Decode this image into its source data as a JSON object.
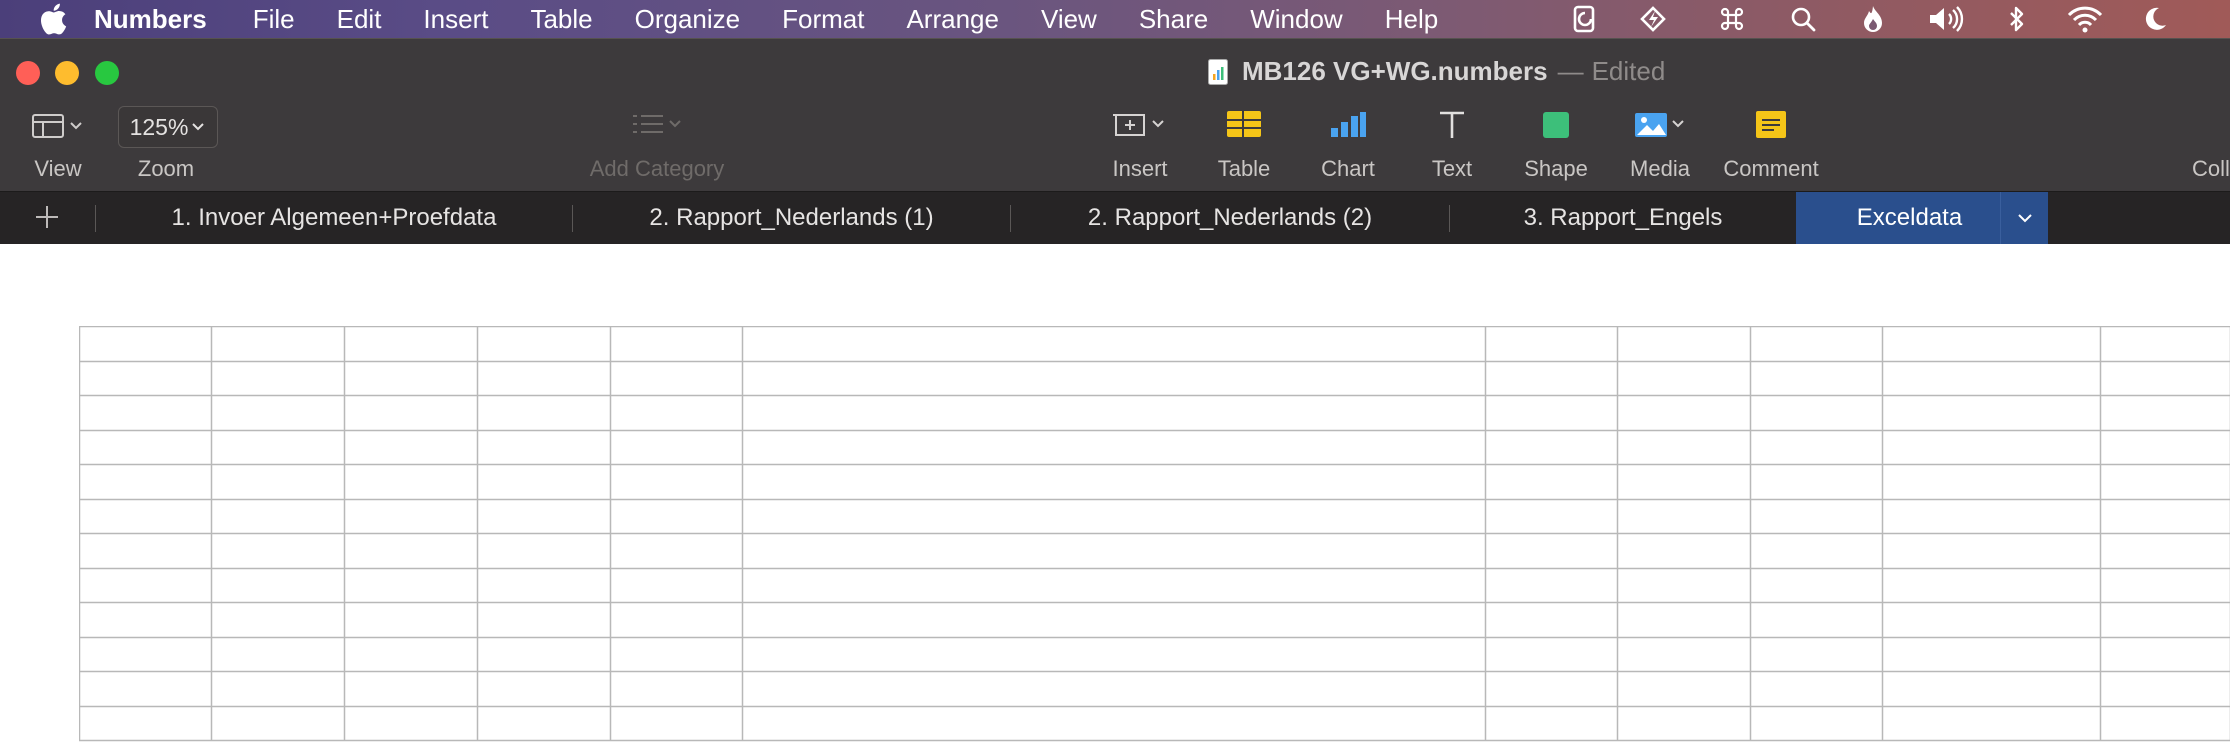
{
  "menubar": {
    "app_name": "Numbers",
    "items": [
      "File",
      "Edit",
      "Insert",
      "Table",
      "Organize",
      "Format",
      "Arrange",
      "View",
      "Share",
      "Window",
      "Help"
    ],
    "status_icons": [
      "clipboard-icon",
      "bolt-app-icon",
      "command-icon",
      "search-icon",
      "flame-icon",
      "volume-icon",
      "bluetooth-icon",
      "wifi-icon",
      "moon-icon"
    ]
  },
  "window": {
    "title": "MB126 VG+WG.numbers",
    "title_separator": "—",
    "status": "Edited"
  },
  "toolbar": {
    "view_label": "View",
    "zoom_value": "125%",
    "zoom_label": "Zoom",
    "add_category_label": "Add Category",
    "insert_label": "Insert",
    "table_label": "Table",
    "chart_label": "Chart",
    "text_label": "Text",
    "shape_label": "Shape",
    "media_label": "Media",
    "comment_label": "Comment",
    "collaborate_label": "Coll"
  },
  "sheets": {
    "tabs": [
      {
        "label": "1. Invoer Algemeen+Proefdata",
        "active": false
      },
      {
        "label": "2. Rapport_Nederlands (1)",
        "active": false
      },
      {
        "label": "2. Rapport_Nederlands (2)",
        "active": false
      },
      {
        "label": "3. Rapport_Engels",
        "active": false
      },
      {
        "label": "Exceldata",
        "active": true
      }
    ]
  },
  "table": {
    "visible_rows": 12,
    "visible_columns": 11
  },
  "colors": {
    "toolbar_bg": "#3d3a3c",
    "tabbar_bg": "#262425",
    "active_tab": "#2a4f8d",
    "grid_line": "#b8b8b8",
    "icon_yellow": "#f5c518",
    "icon_blue": "#4aa3f0",
    "icon_green": "#3dbf7a"
  }
}
